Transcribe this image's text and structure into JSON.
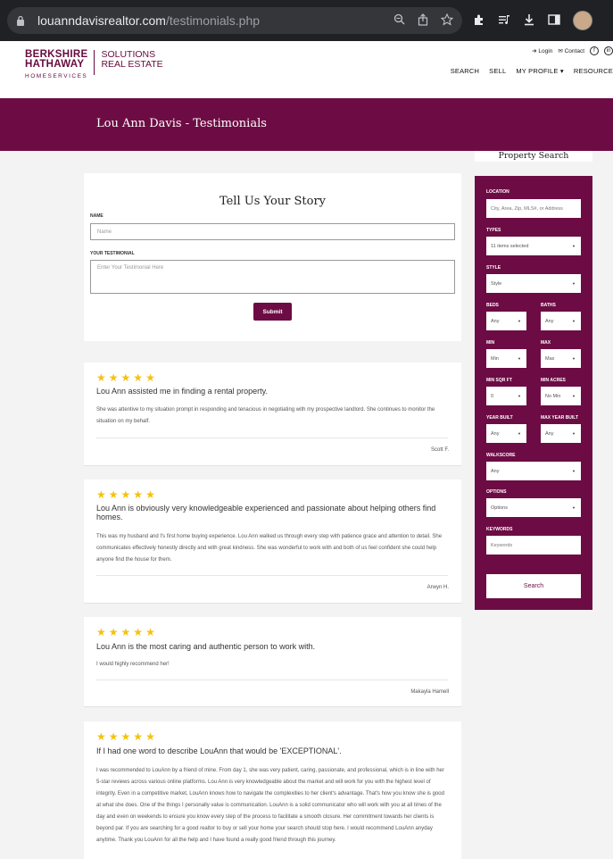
{
  "browser": {
    "url_domain": "louanndavisrealtor.com",
    "url_path": "/testimonials.php"
  },
  "logo": {
    "line1": "BERKSHIRE",
    "line2": "HATHAWAY",
    "line3": "HOMESERVICES",
    "right1": "SOLUTIONS",
    "right2": "REAL ESTATE"
  },
  "top_links": {
    "login": "Login",
    "contact": "Contact"
  },
  "nav": [
    "SEARCH",
    "SELL",
    "MY PROFILE",
    "RESOURCE"
  ],
  "banner_title": "Lou Ann Davis - Testimonials",
  "story_form": {
    "title": "Tell Us Your Story",
    "name_label": "NAME",
    "name_placeholder": "Name",
    "testimonial_label": "YOUR TESTIMONIAL",
    "testimonial_placeholder": "Enter Your Testimonial Here",
    "submit_label": "Submit"
  },
  "reviews": [
    {
      "title": "Lou Ann assisted me in finding a rental property.",
      "body": "She was attentive to my situation prompt in responding and tenacious in negotiating with my prospective landlord. She continues to monitor the situation on my behalf.",
      "author": "Scott F."
    },
    {
      "title": "Lou Ann is obviously very knowledgeable experienced and passionate about helping others find homes.",
      "body": "This was my husband and I's first home buying experience. Lou Ann walked us through every step with patience grace and attention to detail. She communicates effectively honestly directly and with great kindness. She was wonderful to work with and both of us feel confident she could help anyone find the house for them.",
      "author": "Arwyn H."
    },
    {
      "title": "Lou Ann is the most caring and authentic person to work with.",
      "body": "I would highly recommend her!",
      "author": "Makayla Hamell"
    },
    {
      "title": "If I had one word to describe LouAnn that would be 'EXCEPTIONAL'.",
      "body": "I was recommended to LouAnn by a friend of mine. From day 1, she was very patient, caring, passionate, and professional, which is in line with her 5-star reviews across various online platforms. Lou Ann is very knowledgeable about the market and will work for you with the highest level of integrity. Even in a competitive market, LouAnn knows how to navigate the complexities to her client's advantage. That's how you know she is good at what she does. One of the things I personally value is communication. LouAnn is a solid communicator who will work with you at all times of the day and even on weekends to ensure you know every step of the process to facilitate a smooth closure. Her commitment towards her clients is beyond par. If you are searching for a good realtor to buy or sell your home your search should stop here. I would recommend LouAnn anyday anytime. Thank you LouAnn for all the help and I have found a really good friend through this journey.",
      "author": ""
    }
  ],
  "property_search": {
    "title": "Property Search",
    "location_label": "LOCATION",
    "location_placeholder": "City, Area, Zip, MLS#, or Address",
    "types_label": "TYPES",
    "types_value": "11 items selected",
    "style_label": "STYLE",
    "style_value": "Style",
    "beds_label": "BEDS",
    "beds_value": "Any",
    "baths_label": "BATHS",
    "baths_value": "Any",
    "min_label": "MIN",
    "min_value": "Min",
    "max_label": "MAX",
    "max_value": "Max",
    "min_sqft_label": "MIN SQR FT",
    "min_sqft_value": "0",
    "min_acres_label": "MIN ACRES",
    "min_acres_value": "No Min",
    "year_built_label": "YEAR BUILT",
    "year_built_value": "Any",
    "max_year_label": "MAX YEAR BUILT",
    "max_year_value": "Any",
    "walkscore_label": "WALKSCORE",
    "walkscore_value": "Any",
    "options_label": "OPTIONS",
    "options_value": "Options",
    "keywords_label": "KEYWORDS",
    "keywords_placeholder": "Keywords",
    "search_label": "Search"
  },
  "colors": {
    "brand": "#6d0c44",
    "star": "#f4c20d"
  },
  "star_count": 5
}
